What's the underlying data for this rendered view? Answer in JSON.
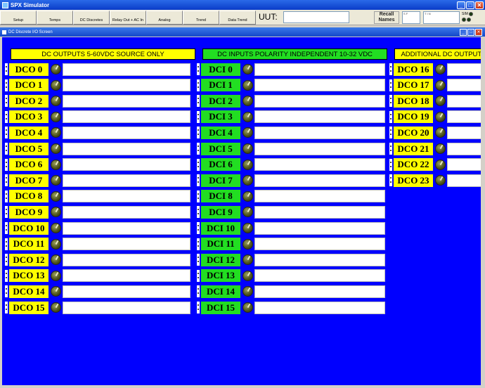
{
  "window": {
    "title": "SPX Simulator"
  },
  "toolbar": {
    "buttons": [
      "Setup",
      "Temps",
      "DC Discretes",
      "Relay Out + AC In",
      "Analog",
      "Trend",
      "Data Trend"
    ],
    "uut_label": "UUT:",
    "uut_value": "",
    "recall_label": "Recall Names",
    "sim_label": "SIM",
    "mini1_label": "S F",
    "mini2_label": "T I N"
  },
  "screen": {
    "title": "DC Discrete I/O Screen"
  },
  "colors": {
    "outputs": "#ffff00",
    "inputs": "#22dd22",
    "background": "#0000ff"
  },
  "columns": [
    {
      "header": "DC OUTPUTS 5-60VDC SOURCE ONLY",
      "items": [
        "DCO 0",
        "DCO 1",
        "DCO 2",
        "DCO 3",
        "DCO 4",
        "DCO 5",
        "DCO 6",
        "DCO 7",
        "DCO 8",
        "DCO 9",
        "DCO 10",
        "DCO 11",
        "DCO 12",
        "DCO 13",
        "DCO 14",
        "DCO 15"
      ]
    },
    {
      "header": "DC INPUTS   POLARITY INDEPENDENT 10-32 VDC",
      "items": [
        "DCI 0",
        "DCI 1",
        "DCI 2",
        "DCI 3",
        "DCI 4",
        "DCI 5",
        "DCI 6",
        "DCI 7",
        "DCI 8",
        "DCI 9",
        "DCI 10",
        "DCI 11",
        "DCI 12",
        "DCI 13",
        "DCI 14",
        "DCI 15"
      ]
    },
    {
      "header": "ADDITIONAL DC OUTPUTS",
      "items": [
        "DCO 16",
        "DCO 17",
        "DCO 18",
        "DCO 19",
        "DCO 20",
        "DCO 21",
        "DCO 22",
        "DCO 23"
      ]
    }
  ]
}
